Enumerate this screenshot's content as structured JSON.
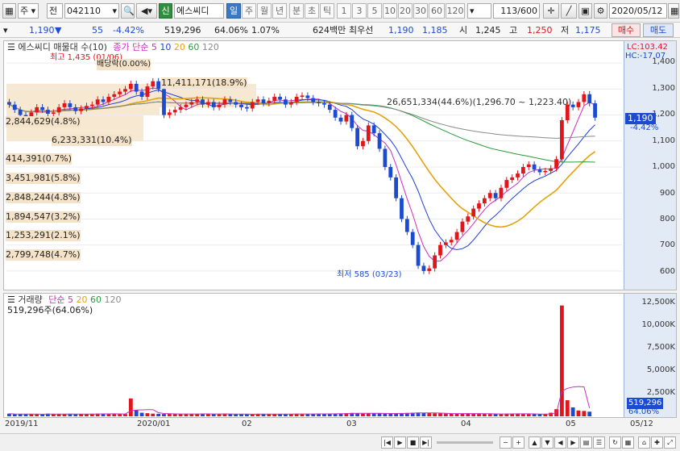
{
  "toolbar": {
    "type": "주",
    "type2": "전",
    "code": "042110",
    "badge": "신",
    "name": "에스씨디",
    "periods": [
      "일",
      "주",
      "월",
      "년",
      "분",
      "초",
      "틱"
    ],
    "active_period": "일",
    "intervals": [
      "1",
      "3",
      "5",
      "10",
      "20",
      "30",
      "60",
      "120"
    ],
    "count": "113/600",
    "date": "2020/05/12"
  },
  "quote": {
    "price": "1,190",
    "change_arrow": "▼",
    "change": "55",
    "change_pct": "-4.42%",
    "volume": "519,296",
    "volume_ratio": "64.06%",
    "turnover_rate": "1.07%",
    "amount": "624백만",
    "bid_label": "최우선",
    "bid": "1,190",
    "ask": "1,185",
    "open_label": "시",
    "open": "1,245",
    "high_label": "고",
    "high": "1,250",
    "low_label": "저",
    "low": "1,175",
    "buy_label": "매수",
    "sell_label": "매도"
  },
  "colors": {
    "up": "#e0161d",
    "down": "#1c4bd1",
    "ma5": "#cc2ec1",
    "ma10": "#1f3fd8",
    "ma20": "#e5a20c",
    "ma60": "#2b9a3c",
    "ma120": "#8a8a8a",
    "panel_bg": "#ffffff",
    "axis_bg": "#e2eaf6"
  },
  "price_panel": {
    "legend": {
      "title": "에스씨디 매물대 수(10)",
      "ma_label": "종가 단순",
      "ma": [
        "5",
        "10",
        "20",
        "60",
        "120"
      ]
    },
    "lc": "LC:103.42",
    "hc": "HC:-17.07",
    "current_tag": "1,190",
    "current_pct": "-4.42%",
    "max_label": "최고 1,435 (01/06)",
    "min_label": "최저 585 (03/23)",
    "dividend_label": "배당락(0.00%)",
    "range_label": "26,651,334(44.6%)(1,296.70 ~ 1,223.40)",
    "volume_profile": [
      "11,411,171(18.9%)",
      "2,844,629(4.8%)",
      "6,233,331(10.4%)",
      "414,391(0.7%)",
      "3,451,981(5.8%)",
      "2,848,244(4.8%)",
      "1,894,547(3.2%)",
      "1,253,291(2.1%)",
      "2,799,748(4.7%)"
    ],
    "y_ticks": [
      "1,400",
      "1,300",
      "1,200",
      "1,100",
      "1,000",
      "900",
      "800",
      "700",
      "600"
    ]
  },
  "volume_panel": {
    "legend": {
      "title": "거래량",
      "ma_label": "단순",
      "ma": [
        "5",
        "20",
        "60",
        "120"
      ]
    },
    "current": "519,296주(64.06%)",
    "y_ticks": [
      "12,500K",
      "10,000K",
      "7,500K",
      "5,000K",
      "2,500K"
    ],
    "tag_value": "519,296",
    "tag_pct": "64.06%"
  },
  "x_ticks": [
    "2019/11",
    "2020/01",
    "02",
    "03",
    "04",
    "05",
    "05/12"
  ],
  "chart_data": {
    "type": "candlestick",
    "ylim": [
      550,
      1450
    ],
    "volume_ylim": [
      0,
      13000
    ],
    "close": [
      1240,
      1220,
      1200,
      1195,
      1210,
      1230,
      1220,
      1205,
      1210,
      1230,
      1245,
      1230,
      1215,
      1225,
      1235,
      1240,
      1260,
      1250,
      1270,
      1280,
      1290,
      1300,
      1320,
      1290,
      1270,
      1310,
      1330,
      1300,
      1200,
      1210,
      1220,
      1230,
      1240,
      1250,
      1260,
      1240,
      1250,
      1230,
      1240,
      1260,
      1250,
      1240,
      1230,
      1225,
      1250,
      1260,
      1245,
      1255,
      1270,
      1260,
      1240,
      1250,
      1270,
      1275,
      1265,
      1250,
      1245,
      1240,
      1220,
      1190,
      1175,
      1200,
      1150,
      1080,
      1100,
      1160,
      1130,
      1070,
      1000,
      960,
      880,
      800,
      750,
      700,
      620,
      600,
      610,
      660,
      700,
      710,
      720,
      750,
      790,
      810,
      840,
      860,
      880,
      900,
      880,
      920,
      950,
      960,
      975,
      1000,
      1010,
      990,
      980,
      985,
      995,
      1030,
      1180,
      1240,
      1230,
      1250,
      1280,
      1245,
      1190
    ],
    "volume": [
      300,
      220,
      250,
      240,
      260,
      230,
      210,
      300,
      250,
      270,
      250,
      240,
      230,
      250,
      260,
      280,
      300,
      250,
      270,
      290,
      240,
      260,
      2000,
      700,
      400,
      350,
      300,
      280,
      260,
      270,
      250,
      260,
      270,
      260,
      250,
      300,
      270,
      250,
      260,
      280,
      250,
      240,
      230,
      220,
      250,
      260,
      250,
      240,
      260,
      270,
      250,
      260,
      280,
      270,
      260,
      250,
      300,
      280,
      260,
      300,
      320,
      350,
      380,
      330,
      300,
      320,
      340,
      360,
      300,
      280,
      320,
      360,
      380,
      400,
      420,
      380,
      360,
      340,
      320,
      300,
      280,
      300,
      320,
      340,
      300,
      280,
      270,
      260,
      250,
      240,
      300,
      320,
      280,
      260,
      250,
      240,
      230,
      250,
      400,
      800,
      12400,
      1800,
      1000,
      650,
      600,
      519
    ]
  }
}
